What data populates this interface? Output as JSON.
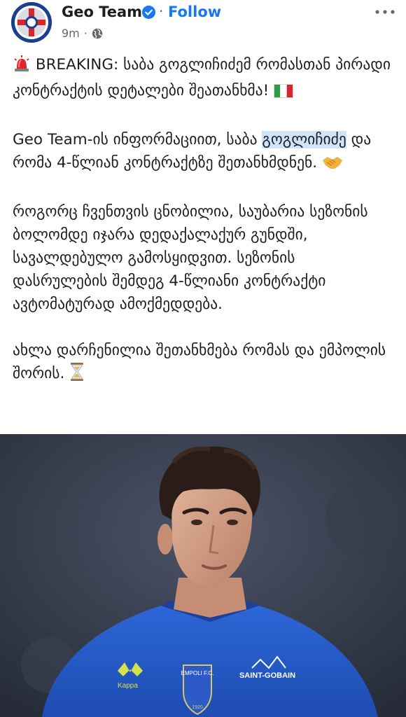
{
  "post": {
    "page_name": "Geo Team",
    "follow_label": "Follow",
    "time_ago": "9m",
    "meta_separator": "·",
    "header_separator": "·",
    "audience_icon": "globe-icon",
    "verified_icon": "verified-badge-icon",
    "more_icon": "more-options-icon",
    "colors": {
      "accent": "#1877f2",
      "secondary_text": "#65676b",
      "highlight": "#cfe3fb"
    }
  },
  "body": {
    "p1_emoji": "siren-emoji",
    "p1_text": "BREAKING: საბა გოგლიჩიძემ რომასთან პირადი კონტრაქტის დეტალები შეათანხმა!",
    "p1_flag": "italy-flag-emoji",
    "p2_before": "Geo Team-ის ინფორმაციით, საბა ",
    "p2_highlight": "გოგლიჩიძე",
    "p2_after": " და რომა 4-წლიან კონტრაქტზე შეთანხმდნენ.",
    "p2_emoji": "handshake-emoji",
    "p3_text": "როგორც ჩვენთვის ცნობილია, საუბარია სეზონის ბოლომდე იჯარა დედაქალაქურ გუნდში, სავალდებულო გამოსყიდვით. სეზონის დასრულების შემდეგ 4-წლიანი კონტრაქტი ავტომატურად ამოქმედდება.",
    "p4_text": "ახლა დარჩენილია შეთანხმება რომას და ემპოლის შორის.",
    "p4_emoji": "hourglass-emoji"
  },
  "photo": {
    "kit_brand": "Kappa",
    "club_badge_text": "EMPOLI F.C.",
    "badge_year": "1920",
    "sponsor": "SAINT-GOBAIN"
  }
}
